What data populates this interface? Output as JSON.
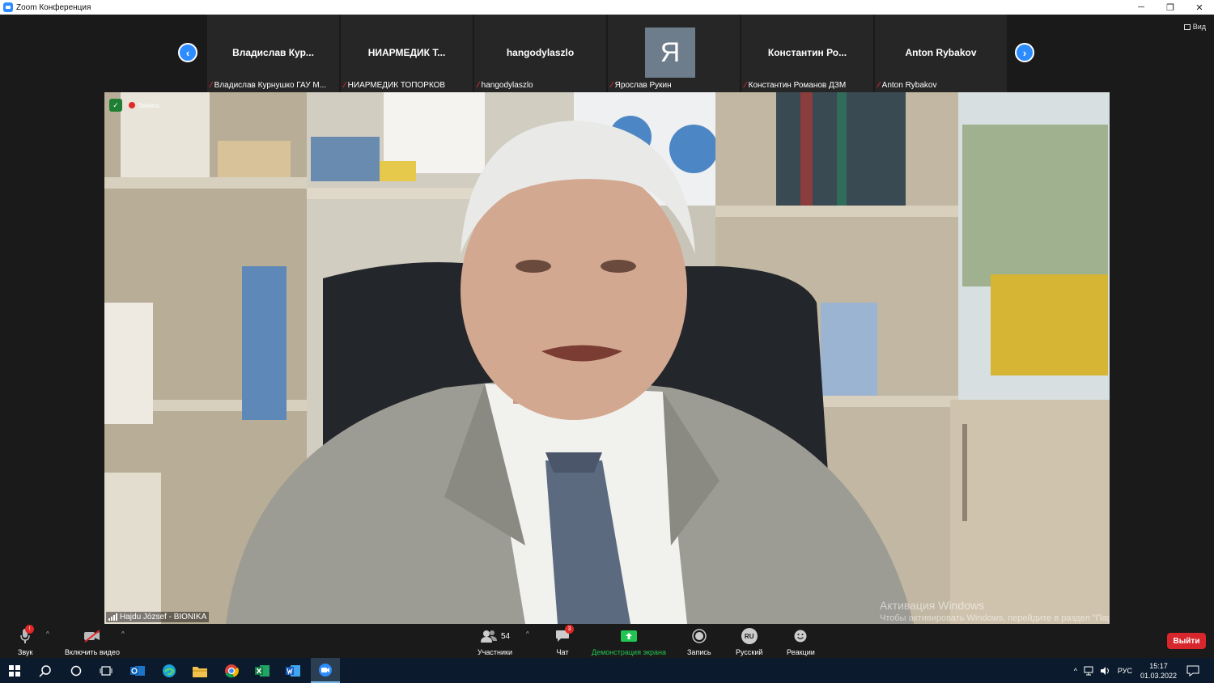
{
  "window": {
    "title": "Zoom Конференция",
    "controls": {
      "minimize": "─",
      "restore": "❐",
      "close": "✕"
    }
  },
  "gallery": {
    "prev_symbol": "‹",
    "next_symbol": "›",
    "view_label": "Вид",
    "participants": [
      {
        "display_name": "Владислав  Кур...",
        "label": "Владислав Курнушко ГАУ М..."
      },
      {
        "display_name": "НИАРМЕДИК  Т...",
        "label": "НИАРМЕДИК ТОПОРКОВ"
      },
      {
        "display_name": "hangodylaszlo",
        "label": "hangodylaszlo"
      },
      {
        "avatar_letter": "Я",
        "label": "Ярослав Рукин"
      },
      {
        "display_name": "Константин  Ро...",
        "label": "Константин Романов ДЗМ"
      },
      {
        "display_name": "Anton Rybakov",
        "label": "Anton Rybakov"
      }
    ]
  },
  "main_video": {
    "recording_label": "Запись",
    "speaker_name": "Hajdu József - BIONIKA",
    "activation_title": "Активация Windows",
    "activation_text": "Чтобы активировать Windows, перейдите в раздел \"Параметры\"."
  },
  "toolbar": {
    "audio_label": "Звук",
    "video_label": "Включить видео",
    "participants_label": "Участники",
    "participants_count": "54",
    "chat_label": "Чат",
    "chat_badge": "3",
    "share_label": "Демонстрация экрана",
    "record_label": "Запись",
    "language_label": "Русский",
    "language_code": "RU",
    "reactions_label": "Реакции",
    "leave_label": "Выйти",
    "colors": {
      "share_green": "#23c552",
      "leave_red": "#d7262c",
      "accent_blue": "#2d8cff"
    }
  },
  "taskbar": {
    "apps": [
      "windows-start-icon",
      "search-icon",
      "cortana-icon",
      "task-view-icon",
      "outlook-icon",
      "edge-icon",
      "file-explorer-icon",
      "chrome-icon",
      "excel-icon",
      "word-icon",
      "zoom-icon"
    ],
    "language": "РУС",
    "time": "15:17",
    "date": "01.03.2022"
  }
}
